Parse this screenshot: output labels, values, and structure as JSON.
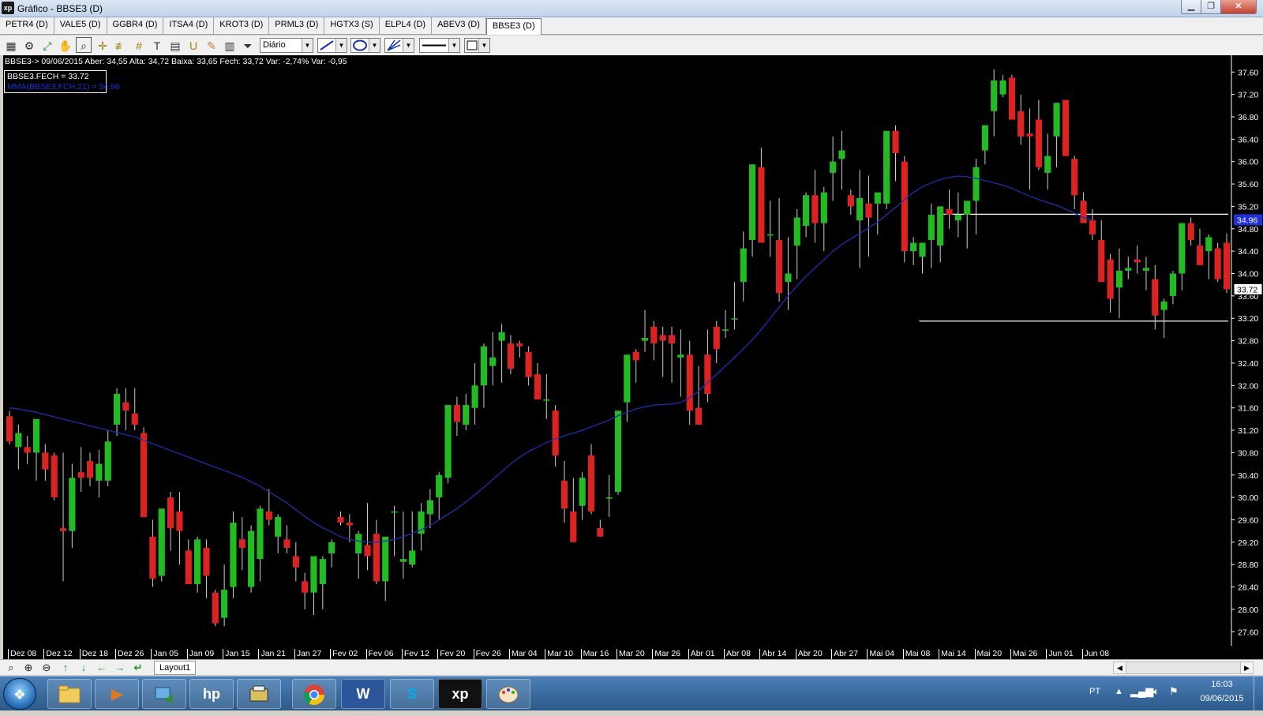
{
  "window": {
    "title": "Gráfico - BBSE3 (D)",
    "logo_text": "xp",
    "minimize": "▁",
    "maximize": "❐",
    "close": "✕"
  },
  "tabs": [
    "PETR4 (D)",
    "VALE5 (D)",
    "GGBR4 (D)",
    "ITSA4 (D)",
    "KROT3 (D)",
    "PRML3 (D)",
    "HGTX3 (S)",
    "ELPL4 (D)",
    "ABEV3 (D)",
    "BBSE3 (D)"
  ],
  "active_tab": "BBSE3 (D)",
  "toolbar": {
    "period": "Diário",
    "icons": [
      "chart-icon",
      "gear-icon",
      "crosshair-icon",
      "hand-icon",
      "zoom-region-icon",
      "cross-cursor-icon",
      "parallel-lines-icon",
      "grid-icon",
      "text-tool-icon",
      "calculator-icon",
      "magnet-icon",
      "eraser-icon",
      "trash-icon",
      "filter-icon"
    ]
  },
  "info_line": "BBSE3-> 09/06/2015 Aber: 34,55 Alta: 34,72 Baixa: 33,65 Fech: 33,72 Var: -2,74% Var: -0,95",
  "legend": {
    "close_label": "BBSE3.FECH = 33.72",
    "ma_label": "MMA(BBSE3.FCH,21) = 34.96"
  },
  "colors": {
    "up": "#22bb22",
    "down": "#dd2222",
    "ma_line": "#1e2fb0",
    "background": "#000000",
    "axis_text": "#ffffff",
    "ma_badge": "#1e2fe0"
  },
  "chart_data": {
    "type": "candlestick",
    "symbol": "BBSE3",
    "y_ticks": [
      "37.60",
      "37.20",
      "36.80",
      "36.40",
      "36.00",
      "35.60",
      "35.20",
      "34.80",
      "34.40",
      "34.00",
      "33.60",
      "33.20",
      "32.80",
      "32.40",
      "32.00",
      "31.60",
      "31.20",
      "30.80",
      "30.40",
      "30.00",
      "29.60",
      "29.20",
      "28.80",
      "28.40",
      "28.00",
      "27.60"
    ],
    "y_range": [
      27.6,
      37.7
    ],
    "x_labels": [
      {
        "label": "Dez 08",
        "index": 0
      },
      {
        "label": "Dez 12",
        "index": 4
      },
      {
        "label": "Dez 18",
        "index": 8
      },
      {
        "label": "Dez 26",
        "index": 12
      },
      {
        "label": "Jan 05",
        "index": 16
      },
      {
        "label": "Jan 09",
        "index": 20
      },
      {
        "label": "Jan 15",
        "index": 24
      },
      {
        "label": "Jan 21",
        "index": 28
      },
      {
        "label": "Jan 27",
        "index": 32
      },
      {
        "label": "Fev 02",
        "index": 36
      },
      {
        "label": "Fev 06",
        "index": 40
      },
      {
        "label": "Fev 12",
        "index": 44
      },
      {
        "label": "Fev 20",
        "index": 48
      },
      {
        "label": "Fev 26",
        "index": 52
      },
      {
        "label": "Mar 04",
        "index": 56
      },
      {
        "label": "Mar 10",
        "index": 60
      },
      {
        "label": "Mar 16",
        "index": 64
      },
      {
        "label": "Mar 20",
        "index": 68
      },
      {
        "label": "Mar 26",
        "index": 72
      },
      {
        "label": "Abr 01",
        "index": 76
      },
      {
        "label": "Abr 08",
        "index": 80
      },
      {
        "label": "Abr 14",
        "index": 84
      },
      {
        "label": "Abr 20",
        "index": 88
      },
      {
        "label": "Abr 27",
        "index": 92
      },
      {
        "label": "Mai 04",
        "index": 96
      },
      {
        "label": "Mai 08",
        "index": 100
      },
      {
        "label": "Mai 14",
        "index": 104
      },
      {
        "label": "Mai 20",
        "index": 108
      },
      {
        "label": "Mai 26",
        "index": 112
      },
      {
        "label": "Jun 01",
        "index": 116
      },
      {
        "label": "Jun 08",
        "index": 120
      }
    ],
    "candles": [
      [
        31.45,
        31.55,
        30.95,
        31.0
      ],
      [
        30.9,
        31.3,
        30.5,
        31.15
      ],
      [
        30.9,
        31.1,
        30.6,
        30.8
      ],
      [
        30.8,
        31.4,
        30.3,
        31.4
      ],
      [
        30.8,
        30.95,
        30.3,
        30.5
      ],
      [
        30.75,
        30.8,
        29.95,
        30.0
      ],
      [
        29.45,
        30.8,
        28.5,
        29.4
      ],
      [
        29.4,
        30.6,
        29.1,
        30.35
      ],
      [
        30.45,
        30.9,
        30.1,
        30.35
      ],
      [
        30.65,
        30.8,
        30.2,
        30.35
      ],
      [
        30.3,
        30.85,
        30.0,
        30.6
      ],
      [
        30.3,
        31.2,
        30.2,
        31.0
      ],
      [
        31.3,
        31.95,
        31.1,
        31.85
      ],
      [
        31.7,
        31.95,
        31.2,
        31.55
      ],
      [
        31.5,
        31.95,
        31.2,
        31.3
      ],
      [
        31.15,
        31.25,
        29.65,
        29.65
      ],
      [
        29.3,
        29.6,
        28.4,
        28.55
      ],
      [
        28.6,
        29.8,
        28.5,
        29.8
      ],
      [
        30.0,
        30.1,
        29.05,
        29.45
      ],
      [
        29.75,
        30.1,
        28.8,
        29.4
      ],
      [
        29.05,
        29.25,
        28.6,
        28.45
      ],
      [
        28.45,
        29.3,
        28.3,
        29.25
      ],
      [
        29.1,
        29.25,
        28.2,
        28.6
      ],
      [
        28.3,
        28.35,
        27.7,
        27.75
      ],
      [
        27.85,
        28.8,
        27.7,
        28.35
      ],
      [
        28.4,
        29.75,
        28.2,
        29.55
      ],
      [
        29.25,
        29.65,
        28.7,
        29.1
      ],
      [
        28.4,
        29.5,
        28.3,
        29.4
      ],
      [
        28.9,
        29.85,
        28.5,
        29.8
      ],
      [
        29.75,
        30.15,
        29.5,
        29.6
      ],
      [
        29.3,
        29.7,
        29.0,
        29.65
      ],
      [
        29.25,
        29.5,
        29.0,
        29.1
      ],
      [
        28.95,
        29.2,
        28.5,
        28.75
      ],
      [
        28.5,
        28.65,
        28.0,
        28.3
      ],
      [
        28.3,
        28.95,
        27.9,
        28.95
      ],
      [
        28.45,
        28.95,
        28.0,
        28.9
      ],
      [
        29.0,
        29.25,
        28.75,
        29.2
      ],
      [
        29.65,
        29.75,
        29.5,
        29.55
      ],
      [
        29.55,
        29.7,
        29.2,
        29.5
      ],
      [
        29.0,
        29.4,
        28.55,
        29.35
      ],
      [
        29.15,
        29.9,
        28.7,
        28.95
      ],
      [
        29.35,
        29.6,
        28.45,
        28.5
      ],
      [
        28.5,
        29.1,
        28.15,
        29.3
      ],
      [
        29.75,
        29.85,
        28.95,
        29.75
      ],
      [
        28.85,
        29.75,
        28.55,
        28.9
      ],
      [
        28.8,
        29.75,
        28.75,
        29.05
      ],
      [
        29.35,
        29.9,
        29.05,
        29.75
      ],
      [
        29.7,
        30.15,
        29.45,
        29.95
      ],
      [
        30.0,
        30.45,
        29.6,
        30.4
      ],
      [
        30.35,
        31.65,
        30.25,
        31.65
      ],
      [
        31.65,
        31.8,
        31.1,
        31.35
      ],
      [
        31.3,
        31.85,
        31.2,
        31.65
      ],
      [
        31.6,
        32.4,
        31.3,
        32.0
      ],
      [
        32.0,
        32.75,
        31.6,
        32.7
      ],
      [
        32.35,
        32.95,
        32.0,
        32.5
      ],
      [
        32.8,
        33.1,
        32.05,
        32.95
      ],
      [
        32.75,
        32.9,
        32.2,
        32.3
      ],
      [
        32.75,
        32.8,
        32.5,
        32.7
      ],
      [
        32.6,
        32.7,
        32.0,
        32.15
      ],
      [
        32.2,
        32.4,
        31.85,
        31.75
      ],
      [
        31.75,
        32.2,
        31.4,
        31.75
      ],
      [
        31.55,
        31.65,
        30.55,
        30.75
      ],
      [
        30.3,
        30.65,
        29.55,
        29.8
      ],
      [
        29.75,
        30.35,
        29.2,
        29.2
      ],
      [
        29.85,
        30.45,
        29.6,
        30.35
      ],
      [
        30.75,
        30.95,
        29.7,
        29.75
      ],
      [
        29.45,
        29.6,
        29.3,
        29.3
      ],
      [
        30.0,
        30.4,
        29.65,
        30.0
      ],
      [
        30.1,
        31.55,
        30.05,
        31.55
      ],
      [
        31.7,
        32.55,
        31.35,
        32.55
      ],
      [
        32.6,
        32.65,
        32.05,
        32.45
      ],
      [
        32.8,
        33.35,
        32.6,
        32.85
      ],
      [
        33.05,
        33.15,
        32.45,
        32.75
      ],
      [
        32.9,
        33.05,
        32.15,
        32.8
      ],
      [
        32.9,
        33.05,
        32.05,
        32.75
      ],
      [
        32.5,
        33.0,
        31.8,
        32.55
      ],
      [
        32.55,
        32.8,
        31.3,
        31.55
      ],
      [
        31.6,
        32.35,
        31.3,
        31.3
      ],
      [
        32.55,
        33.0,
        31.7,
        31.85
      ],
      [
        33.05,
        33.15,
        32.4,
        32.65
      ],
      [
        33.0,
        33.35,
        32.85,
        33.0
      ],
      [
        33.2,
        33.85,
        33.0,
        33.2
      ],
      [
        33.85,
        34.75,
        33.5,
        34.45
      ],
      [
        34.6,
        35.95,
        34.3,
        35.95
      ],
      [
        35.9,
        36.25,
        34.55,
        34.55
      ],
      [
        34.7,
        35.3,
        34.3,
        34.7
      ],
      [
        34.6,
        35.35,
        33.5,
        33.65
      ],
      [
        33.85,
        34.65,
        33.35,
        34.0
      ],
      [
        34.5,
        35.15,
        33.9,
        35.0
      ],
      [
        34.85,
        35.45,
        34.65,
        35.4
      ],
      [
        35.4,
        35.85,
        34.55,
        34.9
      ],
      [
        34.9,
        35.55,
        34.4,
        35.45
      ],
      [
        35.8,
        36.45,
        35.3,
        36.0
      ],
      [
        36.05,
        36.55,
        35.5,
        36.2
      ],
      [
        35.4,
        35.5,
        35.05,
        35.2
      ],
      [
        34.95,
        35.85,
        34.1,
        35.35
      ],
      [
        35.25,
        35.75,
        34.3,
        35.0
      ],
      [
        35.25,
        35.3,
        34.7,
        35.45
      ],
      [
        35.25,
        36.35,
        35.15,
        36.55
      ],
      [
        36.55,
        36.65,
        35.65,
        36.15
      ],
      [
        36.0,
        36.1,
        34.2,
        34.4
      ],
      [
        34.4,
        34.65,
        34.15,
        34.55
      ],
      [
        34.3,
        34.55,
        34.0,
        34.55
      ],
      [
        34.6,
        35.25,
        34.1,
        35.05
      ],
      [
        34.5,
        35.15,
        34.2,
        35.2
      ],
      [
        35.15,
        35.5,
        34.8,
        35.05
      ],
      [
        34.95,
        35.45,
        34.65,
        35.05
      ],
      [
        35.05,
        35.25,
        34.45,
        35.3
      ],
      [
        35.3,
        36.05,
        34.7,
        35.9
      ],
      [
        36.2,
        36.55,
        35.95,
        36.65
      ],
      [
        36.9,
        37.65,
        36.45,
        37.45
      ],
      [
        37.2,
        37.55,
        37.15,
        37.45
      ],
      [
        37.5,
        37.55,
        36.75,
        36.75
      ],
      [
        36.9,
        37.2,
        36.3,
        36.45
      ],
      [
        36.5,
        36.95,
        35.5,
        36.45
      ],
      [
        36.75,
        37.1,
        35.85,
        35.9
      ],
      [
        35.8,
        36.5,
        35.5,
        36.1
      ],
      [
        36.45,
        37.05,
        35.9,
        37.05
      ],
      [
        37.1,
        37.1,
        36.1,
        36.1
      ],
      [
        36.05,
        36.1,
        35.15,
        35.4
      ],
      [
        35.3,
        35.45,
        35.0,
        34.9
      ],
      [
        34.95,
        35.15,
        34.6,
        34.7
      ],
      [
        34.6,
        34.95,
        33.85,
        33.85
      ],
      [
        34.25,
        34.35,
        33.3,
        33.55
      ],
      [
        33.75,
        34.45,
        33.2,
        34.05
      ],
      [
        34.05,
        34.3,
        33.9,
        34.1
      ],
      [
        34.25,
        34.5,
        34.0,
        34.2
      ],
      [
        34.05,
        34.3,
        33.7,
        34.1
      ],
      [
        33.9,
        34.15,
        33.0,
        33.25
      ],
      [
        33.35,
        33.55,
        32.85,
        33.5
      ],
      [
        33.6,
        34.05,
        33.45,
        34.0
      ],
      [
        34.0,
        34.9,
        33.7,
        34.9
      ],
      [
        34.9,
        35.0,
        34.5,
        34.6
      ],
      [
        34.5,
        34.8,
        34.25,
        34.15
      ],
      [
        34.4,
        34.7,
        33.9,
        34.65
      ],
      [
        34.45,
        34.55,
        33.85,
        33.9
      ],
      [
        34.55,
        34.72,
        33.65,
        33.72
      ]
    ],
    "ma21": [
      31.6,
      31.58,
      31.55,
      31.52,
      31.48,
      31.44,
      31.4,
      31.36,
      31.32,
      31.28,
      31.24,
      31.2,
      31.16,
      31.12,
      31.08,
      31.02,
      30.96,
      30.9,
      30.84,
      30.78,
      30.72,
      30.66,
      30.6,
      30.54,
      30.48,
      30.42,
      30.36,
      30.28,
      30.2,
      30.1,
      30.0,
      29.9,
      29.78,
      29.66,
      29.55,
      29.46,
      29.38,
      29.3,
      29.25,
      29.22,
      29.2,
      29.2,
      29.22,
      29.25,
      29.3,
      29.36,
      29.42,
      29.5,
      29.6,
      29.7,
      29.8,
      29.92,
      30.05,
      30.18,
      30.32,
      30.46,
      30.6,
      30.72,
      30.82,
      30.9,
      30.98,
      31.05,
      31.1,
      31.15,
      31.2,
      31.26,
      31.32,
      31.38,
      31.46,
      31.52,
      31.58,
      31.62,
      31.65,
      31.66,
      31.67,
      31.7,
      31.78,
      31.9,
      32.05,
      32.2,
      32.35,
      32.5,
      32.65,
      32.82,
      33.0,
      33.2,
      33.4,
      33.6,
      33.78,
      33.95,
      34.1,
      34.25,
      34.4,
      34.52,
      34.62,
      34.72,
      34.82,
      34.92,
      35.05,
      35.18,
      35.32,
      35.45,
      35.55,
      35.62,
      35.68,
      35.72,
      35.74,
      35.73,
      35.7,
      35.66,
      35.62,
      35.58,
      35.52,
      35.45,
      35.38,
      35.32,
      35.27,
      35.22,
      35.15,
      35.08,
      35.0,
      34.96
    ],
    "horizontal_lines": [
      {
        "price": 35.06,
        "from_index": 104
      },
      {
        "price": 33.15,
        "from_index": 102
      }
    ],
    "last_close_badge": "33.72",
    "ma_badge": "34.96"
  },
  "bottom_bar": {
    "icons": [
      "zoom-icon",
      "zoom-in-icon",
      "zoom-out-icon",
      "arrow-up-icon",
      "arrow-down-icon",
      "arrow-left-icon",
      "arrow-right-icon",
      "arrow-return-icon"
    ],
    "layout_tab": "Layout1"
  },
  "taskbar": {
    "apps": [
      "windows-explorer-icon",
      "media-player-icon",
      "network-icon",
      "hp-icon",
      "scanner-icon",
      "chrome-icon",
      "word-icon",
      "skype-icon",
      "xp-icon",
      "paint-icon"
    ],
    "app_labels": [
      "",
      "▶",
      "",
      "hp",
      "",
      "",
      "W",
      "S",
      "xp",
      ""
    ],
    "language": "PT",
    "time": "16:03",
    "date": "09/06/2015"
  }
}
